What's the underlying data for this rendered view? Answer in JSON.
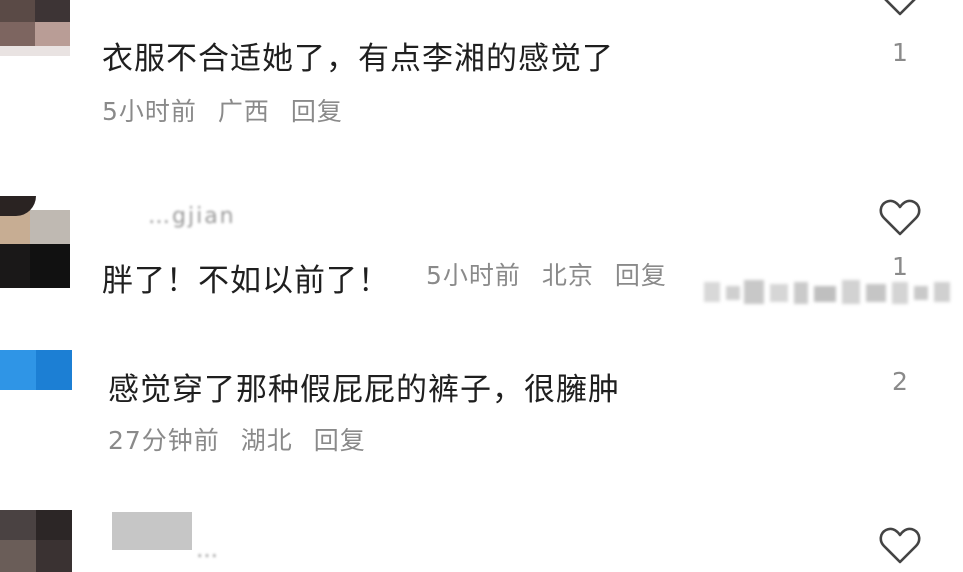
{
  "comments": [
    {
      "text": "衣服不合适她了，有点李湘的感觉了",
      "time": "5小时前",
      "location": "广西",
      "reply": "回复",
      "likes": "1"
    },
    {
      "username": "…gjian",
      "text": "胖了！不如以前了！",
      "time": "5小时前",
      "location": "北京",
      "reply": "回复",
      "likes": "1"
    },
    {
      "text": "感觉穿了那种假屁屁的裤子，很臃肿",
      "time": "27分钟前",
      "location": "湖北",
      "reply": "回复",
      "likes": "2"
    },
    {
      "username": "…"
    }
  ],
  "icons": {
    "like": "heart-outline-icon"
  },
  "colors": {
    "text": "#1f1f1f",
    "meta": "#8a8a8a",
    "icon": "#444444"
  }
}
